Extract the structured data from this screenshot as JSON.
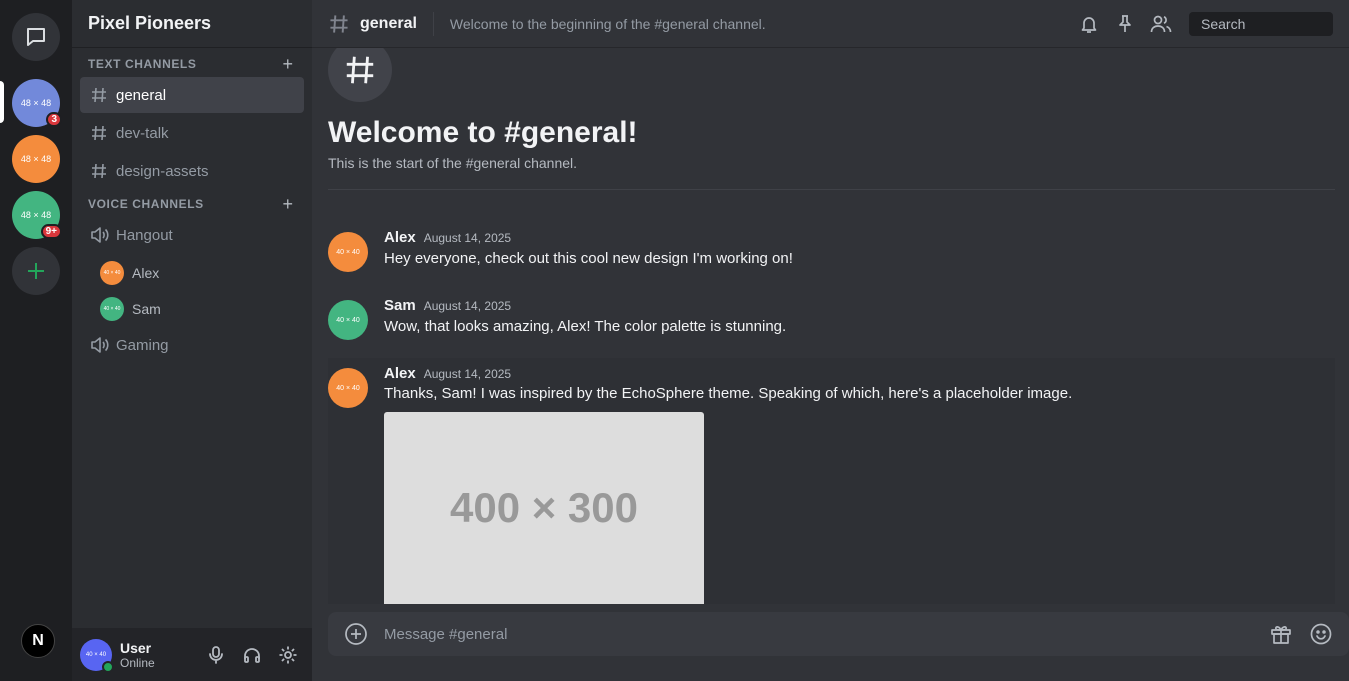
{
  "rail": {
    "servers": [
      {
        "label": "48 × 48",
        "color": "#7289da",
        "badge": "3"
      },
      {
        "label": "48 × 48",
        "color": "#f48c3d",
        "badge": ""
      },
      {
        "label": "48 × 48",
        "color": "#43b581",
        "badge": "9+"
      }
    ],
    "footer_logo": "N"
  },
  "sidebar": {
    "guild_name": "Pixel Pioneers",
    "text_category": "TEXT CHANNELS",
    "text_channels": [
      "general",
      "dev-talk",
      "design-assets"
    ],
    "voice_category": "VOICE CHANNELS",
    "voice_channels": [
      "Hangout",
      "Gaming"
    ],
    "voice_users": [
      {
        "name": "Alex",
        "avatar": "40 × 40",
        "color": "#f48c3d"
      },
      {
        "name": "Sam",
        "avatar": "40 × 40",
        "color": "#43b581"
      }
    ],
    "user": {
      "name": "User",
      "status": "Online",
      "avatar": "40 × 40"
    }
  },
  "topbar": {
    "channel": "general",
    "topic": "Welcome to the beginning of the #general channel.",
    "search_placeholder": "Search"
  },
  "welcome": {
    "icon": "#",
    "title": "Welcome to #general!",
    "subtitle": "This is the start of the #general channel."
  },
  "messages": [
    {
      "author": "Alex",
      "time": "August 14, 2025",
      "text": "Hey everyone, check out this cool new design I'm working on!",
      "avatar": "40 × 40",
      "color": "#f48c3d"
    },
    {
      "author": "Sam",
      "time": "August 14, 2025",
      "text": "Wow, that looks amazing, Alex! The color palette is stunning.",
      "avatar": "40 × 40",
      "color": "#43b581"
    },
    {
      "author": "Alex",
      "time": "August 14, 2025",
      "text": "Thanks, Sam! I was inspired by the EchoSphere theme. Speaking of which, here's a placeholder image.",
      "avatar": "40 × 40",
      "color": "#f48c3d",
      "image_label": "400 × 300"
    }
  ],
  "composer": {
    "placeholder": "Message #general"
  }
}
